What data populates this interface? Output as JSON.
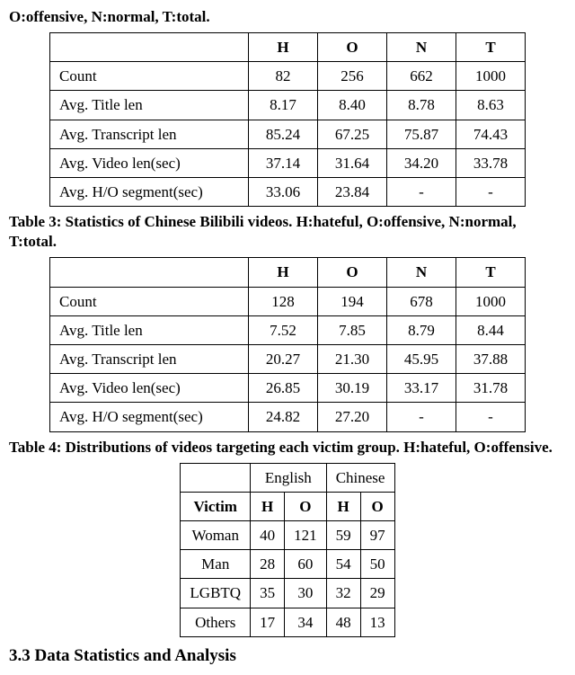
{
  "caption2_part": "O:offensive, N:normal, T:total.",
  "table2": {
    "headers": [
      "",
      "H",
      "O",
      "N",
      "T"
    ],
    "rows": [
      {
        "label": "Count",
        "H": "82",
        "O": "256",
        "N": "662",
        "T": "1000"
      },
      {
        "label": "Avg. Title len",
        "H": "8.17",
        "O": "8.40",
        "N": "8.78",
        "T": "8.63"
      },
      {
        "label": "Avg. Transcript len",
        "H": "85.24",
        "O": "67.25",
        "N": "75.87",
        "T": "74.43"
      },
      {
        "label": "Avg. Video len(sec)",
        "H": "37.14",
        "O": "31.64",
        "N": "34.20",
        "T": "33.78"
      },
      {
        "label": "Avg. H/O segment(sec)",
        "H": "33.06",
        "O": "23.84",
        "N": "-",
        "T": "-"
      }
    ]
  },
  "caption3": "Table 3: Statistics of Chinese Bilibili videos. H:hateful, O:offensive, N:normal, T:total.",
  "table3": {
    "headers": [
      "",
      "H",
      "O",
      "N",
      "T"
    ],
    "rows": [
      {
        "label": "Count",
        "H": "128",
        "O": "194",
        "N": "678",
        "T": "1000"
      },
      {
        "label": "Avg. Title len",
        "H": "7.52",
        "O": "7.85",
        "N": "8.79",
        "T": "8.44"
      },
      {
        "label": "Avg. Transcript len",
        "H": "20.27",
        "O": "21.30",
        "N": "45.95",
        "T": "37.88"
      },
      {
        "label": "Avg. Video len(sec)",
        "H": "26.85",
        "O": "30.19",
        "N": "33.17",
        "T": "31.78"
      },
      {
        "label": "Avg. H/O segment(sec)",
        "H": "24.82",
        "O": "27.20",
        "N": "-",
        "T": "-"
      }
    ]
  },
  "caption4": "Table 4: Distributions of videos targeting each victim group. H:hateful, O:offensive.",
  "table4": {
    "lang_headers": [
      "English",
      "Chinese"
    ],
    "victim_label": "Victim",
    "sub_headers": [
      "H",
      "O",
      "H",
      "O"
    ],
    "rows": [
      {
        "label": "Woman",
        "EH": "40",
        "EO": "121",
        "CH": "59",
        "CO": "97"
      },
      {
        "label": "Man",
        "EH": "28",
        "EO": "60",
        "CH": "54",
        "CO": "50"
      },
      {
        "label": "LGBTQ",
        "EH": "35",
        "EO": "30",
        "CH": "32",
        "CO": "29"
      },
      {
        "label": "Others",
        "EH": "17",
        "EO": "34",
        "CH": "48",
        "CO": "13"
      }
    ]
  },
  "section_heading": "3.3    Data Statistics and Analysis"
}
